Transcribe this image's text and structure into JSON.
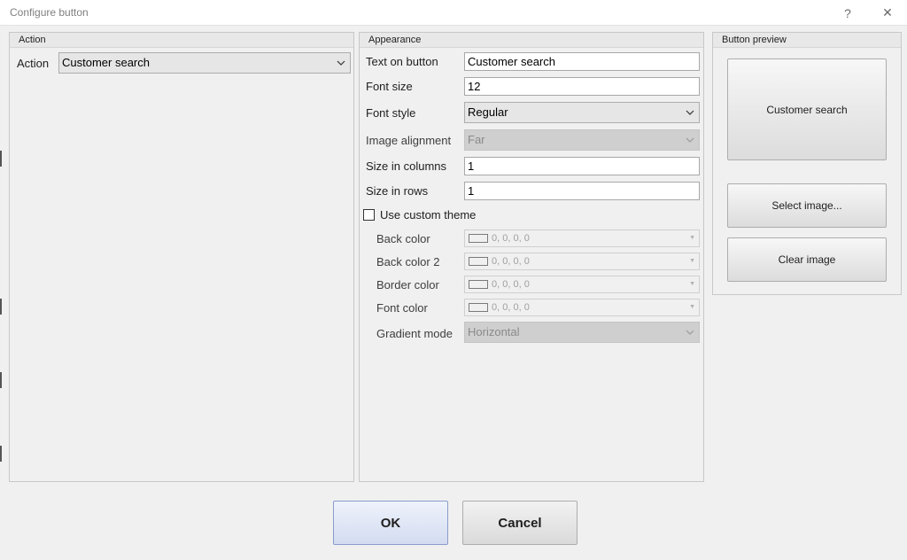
{
  "window": {
    "title": "Configure button",
    "help_glyph": "?",
    "close_glyph": "✕"
  },
  "action_group": {
    "header": "Action",
    "action_label": "Action",
    "action_value": "Customer search"
  },
  "appearance_group": {
    "header": "Appearance",
    "text_on_button": {
      "label": "Text on button",
      "value": "Customer search"
    },
    "font_size": {
      "label": "Font size",
      "value": "12"
    },
    "font_style": {
      "label": "Font style",
      "value": "Regular"
    },
    "image_alignment": {
      "label": "Image alignment",
      "value": "Far"
    },
    "size_in_columns": {
      "label": "Size in columns",
      "value": "1"
    },
    "size_in_rows": {
      "label": "Size in rows",
      "value": "1"
    },
    "use_custom_theme": {
      "label": "Use custom theme",
      "checked": false
    },
    "back_color": {
      "label": "Back color",
      "value": "0, 0, 0, 0"
    },
    "back_color_2": {
      "label": "Back color 2",
      "value": "0, 0, 0, 0"
    },
    "border_color": {
      "label": "Border color",
      "value": "0, 0, 0, 0"
    },
    "font_color": {
      "label": "Font color",
      "value": "0, 0, 0, 0"
    },
    "gradient_mode": {
      "label": "Gradient mode",
      "value": "Horizontal"
    }
  },
  "preview_group": {
    "header": "Button preview",
    "preview_text": "Customer search",
    "select_image_label": "Select image...",
    "clear_image_label": "Clear image"
  },
  "footer": {
    "ok_label": "OK",
    "cancel_label": "Cancel"
  }
}
